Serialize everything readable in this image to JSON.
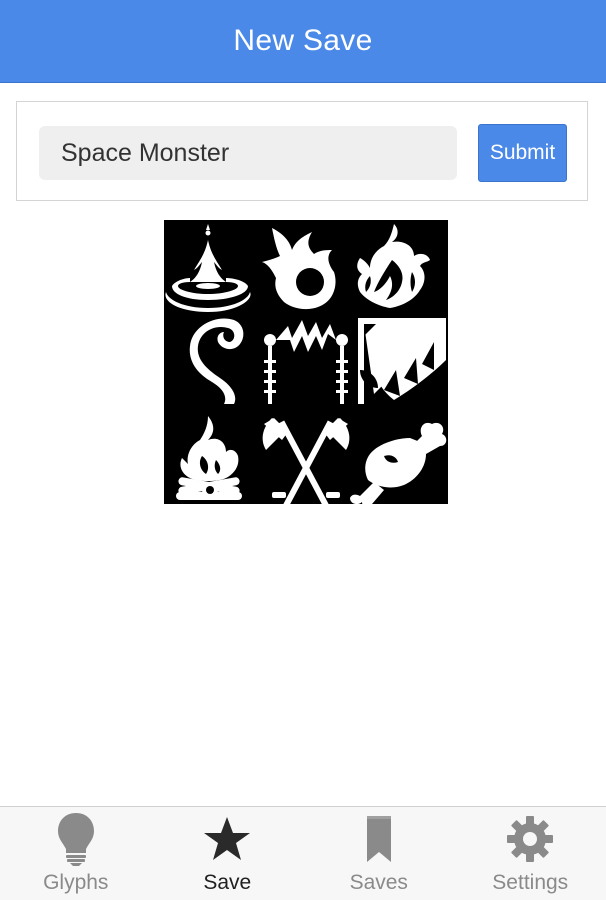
{
  "header": {
    "title": "New Save"
  },
  "form": {
    "name_value": "Space Monster",
    "submit_label": "Submit"
  },
  "glyphs": [
    {
      "icon": "water-drop-splash-icon"
    },
    {
      "icon": "fireball-icon"
    },
    {
      "icon": "flame-icon"
    },
    {
      "icon": "tentacle-icon"
    },
    {
      "icon": "lightning-staffs-icon"
    },
    {
      "icon": "monster-jaw-icon"
    },
    {
      "icon": "campfire-icon"
    },
    {
      "icon": "crossed-axes-icon"
    },
    {
      "icon": "meat-icon"
    }
  ],
  "tabbar": {
    "tabs": [
      {
        "label": "Glyphs",
        "icon": "lightbulb-icon",
        "active": false
      },
      {
        "label": "Save",
        "icon": "star-icon",
        "active": true
      },
      {
        "label": "Saves",
        "icon": "bookmark-icon",
        "active": false
      },
      {
        "label": "Settings",
        "icon": "gear-icon",
        "active": false
      }
    ]
  },
  "colors": {
    "accent": "#4a89e8",
    "tab_active": "#1f1f1f",
    "tab_inactive": "#8a8a8a",
    "board_bg": "#000000"
  }
}
